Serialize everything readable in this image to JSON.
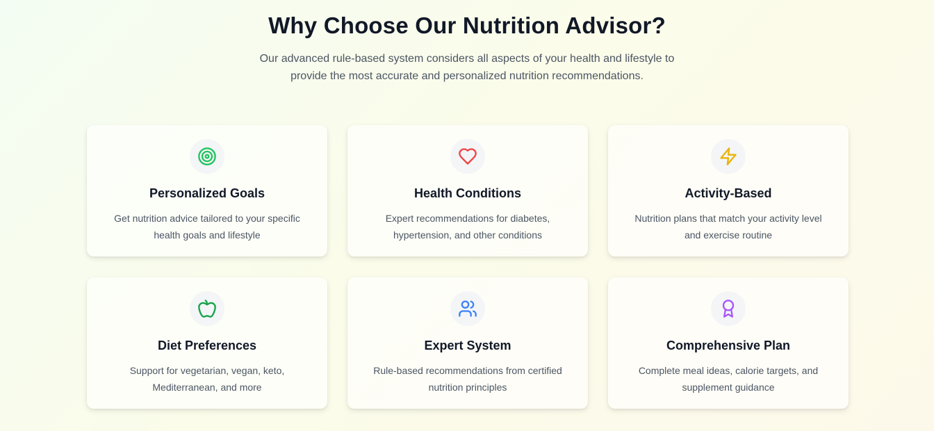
{
  "header": {
    "title": "Why Choose Our Nutrition Advisor?",
    "subtitle": "Our advanced rule-based system considers all aspects of your health and lifestyle to provide the most accurate and personalized nutrition recommendations."
  },
  "features": [
    {
      "icon": "target-icon",
      "color": "#22c55e",
      "title": "Personalized Goals",
      "description": "Get nutrition advice tailored to your specific health goals and lifestyle"
    },
    {
      "icon": "heart-icon",
      "color": "#ef4444",
      "title": "Health Conditions",
      "description": "Expert recommendations for diabetes, hypertension, and other conditions"
    },
    {
      "icon": "lightning-icon",
      "color": "#eab308",
      "title": "Activity-Based",
      "description": "Nutrition plans that match your activity level and exercise routine"
    },
    {
      "icon": "apple-icon",
      "color": "#16a34a",
      "title": "Diet Preferences",
      "description": "Support for vegetarian, vegan, keto, Mediterranean, and more"
    },
    {
      "icon": "users-icon",
      "color": "#3b82f6",
      "title": "Expert System",
      "description": "Rule-based recommendations from certified nutrition principles"
    },
    {
      "icon": "award-icon",
      "color": "#a855f7",
      "title": "Comprehensive Plan",
      "description": "Complete meal ideas, calorie targets, and supplement guidance"
    }
  ]
}
